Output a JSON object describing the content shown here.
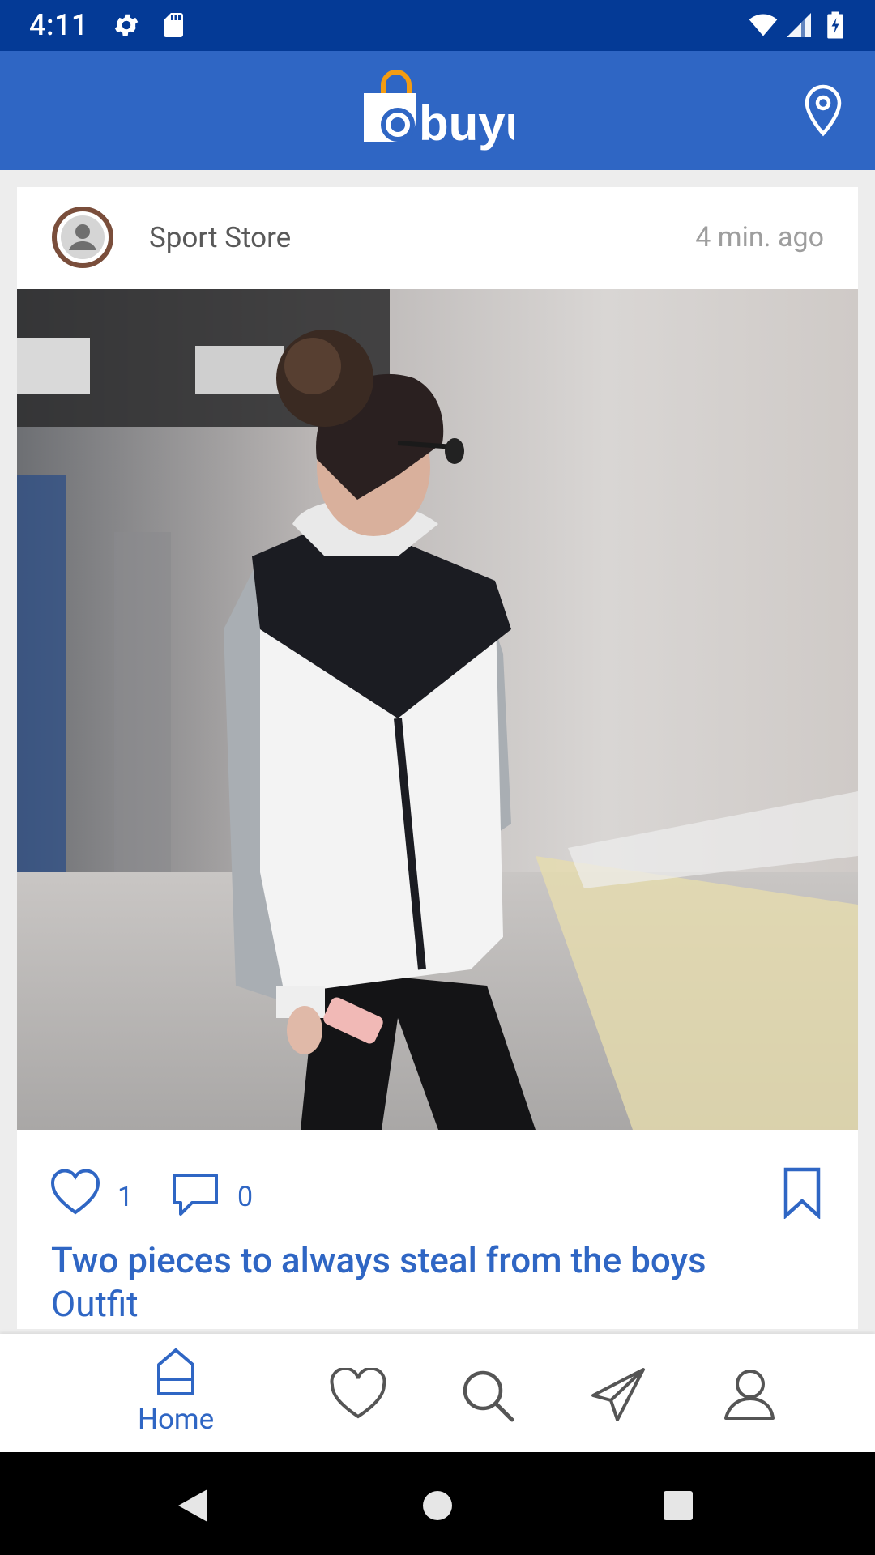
{
  "status_bar": {
    "time": "4:11",
    "icons": [
      "settings-icon",
      "sd-card-icon",
      "wifi-icon",
      "signal-icon",
      "battery-icon"
    ]
  },
  "app_bar": {
    "logo_text": "buyu",
    "location_icon": "location-pin-icon"
  },
  "post": {
    "store_name": "Sport Store",
    "time_ago": "4 min. ago",
    "likes": "1",
    "comments": "0",
    "title": "Two pieces to always steal from the boys",
    "subtitle": "Outfit"
  },
  "bottom_nav": {
    "items": [
      {
        "label": "Home",
        "icon": "home-icon",
        "active": true
      },
      {
        "label": "",
        "icon": "heart-icon"
      },
      {
        "label": "",
        "icon": "search-icon"
      },
      {
        "label": "",
        "icon": "send-icon"
      },
      {
        "label": "",
        "icon": "profile-icon"
      }
    ]
  },
  "colors": {
    "status_bar": "#043a96",
    "primary": "#2f66c4",
    "logo_bag_handle": "#f39c12"
  }
}
